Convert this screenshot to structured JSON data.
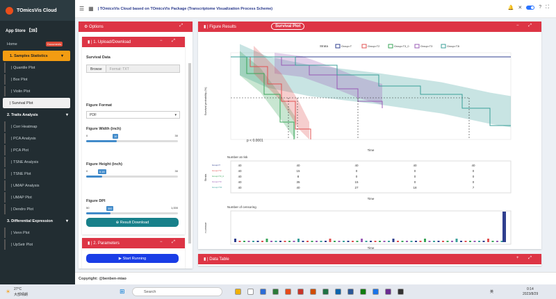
{
  "app": {
    "title": "TOmicsVis Cloud",
    "header": "| TOmicsVis Cloud based on TOmicsVis Package (Transcriptome Visualization Process Scheme)",
    "footer": "Copyright: @benben-miao"
  },
  "sidebar": {
    "appstore": "App Store 【39】",
    "items": [
      {
        "label": "Home",
        "badge": "Documents",
        "kind": "plain"
      },
      {
        "label": "1. Samples Statistics",
        "kind": "hl"
      },
      {
        "label": "| Quantile Plot",
        "kind": "sub"
      },
      {
        "label": "| Box Plot",
        "kind": "sub"
      },
      {
        "label": "| Violin Plot",
        "kind": "sub"
      },
      {
        "label": "| Survival Plot",
        "kind": "active"
      },
      {
        "label": "2. Traits Analysis",
        "kind": "group"
      },
      {
        "label": "| Corr Heatmap",
        "kind": "sub"
      },
      {
        "label": "| PCA Analysis",
        "kind": "sub"
      },
      {
        "label": "| PCA Plot",
        "kind": "sub"
      },
      {
        "label": "| TSNE Analysis",
        "kind": "sub"
      },
      {
        "label": "| TSNE Plot",
        "kind": "sub"
      },
      {
        "label": "| UMAP Analysis",
        "kind": "sub"
      },
      {
        "label": "| UMAP Plot",
        "kind": "sub"
      },
      {
        "label": "| Dendro Plot",
        "kind": "sub"
      },
      {
        "label": "3. Differential Expression",
        "kind": "group"
      },
      {
        "label": "| Venn Plot",
        "kind": "sub"
      },
      {
        "label": "| UpSetr Plot",
        "kind": "sub"
      }
    ]
  },
  "options": {
    "title": "Options",
    "upload": "| 1. Upload/Download",
    "survival_data": "Survival Data",
    "browse": "Browse",
    "format_placeholder": "Format: TXT",
    "figure_format": "Figure Format",
    "format_value": "PDF",
    "width_label": "Figure Width (inch)",
    "width_min": "0",
    "width_max": "30",
    "width_val": "10",
    "width_fill": 0.333,
    "height_label": "Figure Height (inch)",
    "height_min": "0",
    "height_max": "30",
    "height_val": "5.18",
    "height_fill": 0.173,
    "dpi_label": "Figure DPI",
    "dpi_min": "50",
    "dpi_max": "1,000",
    "dpi_val": "300",
    "dpi_fill": 0.263,
    "dpi_ticks": [
      "50",
      "162",
      "208",
      "254",
      "350",
      "444",
      "538",
      "632",
      "726",
      "814",
      "1,000"
    ],
    "download": "Result Download",
    "params": "| 2. Parameters",
    "run": "Start Running"
  },
  "results": {
    "title": "| Figure Results",
    "tag": "Survival Plot",
    "data_table": "| Data Table"
  },
  "plot": {
    "strata_label": "Strata",
    "strata": [
      "Group=T",
      "Group=T2",
      "Group=T3_0",
      "Group=T3",
      "Group=T3i"
    ],
    "colors": [
      "#2f3f8f",
      "#e05050",
      "#3aa65a",
      "#9a5bb5",
      "#3a9f9a"
    ],
    "ylabel": "Survival probability (%)",
    "xlabel": "Time",
    "pval": "p < 0.0001",
    "risk_title": "Number at risk",
    "risk_ylabel": "Strata",
    "risk_xlabel": "Time",
    "risk": [
      [
        "40",
        "40",
        "40",
        "40",
        "40"
      ],
      [
        "40",
        "15",
        "0",
        "0",
        "0"
      ],
      [
        "40",
        "8",
        "0",
        "0",
        "0"
      ],
      [
        "40",
        "35",
        "15",
        "0",
        "0"
      ],
      [
        "40",
        "40",
        "27",
        "18",
        "7"
      ]
    ],
    "cens_title": "Number of censoring",
    "cens_ylabel": "n.censor",
    "cens_xlabel": "Time"
  },
  "taskbar": {
    "weather": "27°C",
    "weather2": "大部晴朗",
    "search": "Search",
    "lang": "英",
    "time": "0:14",
    "date": "2023/8/29"
  }
}
